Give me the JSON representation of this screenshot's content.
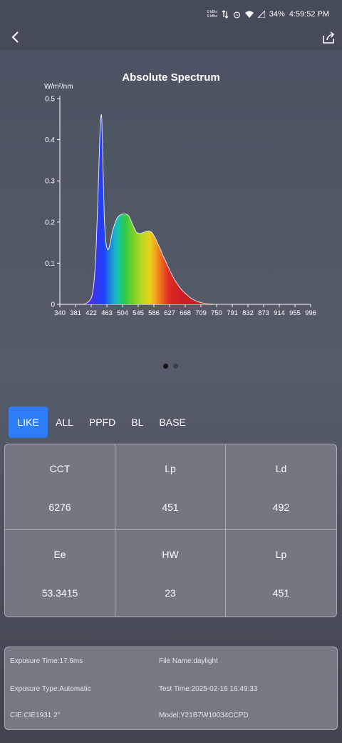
{
  "status": {
    "net_up": "0 kB/s",
    "net_down": "0 kB/s",
    "battery": "34%",
    "time": "4:59:52 PM"
  },
  "icons": {
    "back": "back-arrow-icon",
    "share": "share-icon"
  },
  "chart_data": {
    "type": "area",
    "title": "Absolute Spectrum",
    "ylabel": "W/m²/nm",
    "xlabel": "",
    "xlim": [
      340,
      996
    ],
    "ylim": [
      0,
      0.5
    ],
    "x_ticks": [
      "340",
      "381",
      "422",
      "463",
      "504",
      "545",
      "586",
      "627",
      "668",
      "709",
      "750",
      "791",
      "832",
      "873",
      "914",
      "955",
      "996"
    ],
    "y_ticks": [
      "0",
      "0.1",
      "0.2",
      "0.3",
      "0.4",
      "0.5"
    ],
    "x": [
      400,
      410,
      420,
      425,
      430,
      435,
      440,
      445,
      448,
      450,
      453,
      456,
      460,
      465,
      470,
      475,
      480,
      490,
      500,
      510,
      520,
      530,
      540,
      550,
      560,
      570,
      580,
      590,
      600,
      610,
      620,
      630,
      640,
      650,
      660,
      670,
      680,
      690,
      700,
      710,
      720,
      730,
      740,
      750,
      760,
      770,
      780,
      790
    ],
    "values": [
      0,
      0.003,
      0.012,
      0.025,
      0.06,
      0.14,
      0.27,
      0.42,
      0.46,
      0.44,
      0.33,
      0.22,
      0.155,
      0.133,
      0.142,
      0.165,
      0.185,
      0.21,
      0.218,
      0.22,
      0.215,
      0.195,
      0.176,
      0.172,
      0.175,
      0.178,
      0.175,
      0.16,
      0.14,
      0.118,
      0.098,
      0.078,
      0.06,
      0.046,
      0.034,
      0.025,
      0.017,
      0.011,
      0.007,
      0.004,
      0.002,
      0.001,
      0.0005,
      0,
      0,
      0,
      0,
      0
    ],
    "grid": false,
    "legend": "none"
  },
  "pagination": {
    "pages": 2,
    "current": 0
  },
  "tabs": [
    "LIKE",
    "ALL",
    "PPFD",
    "BL",
    "BASE"
  ],
  "metrics": [
    {
      "label": "CCT",
      "value": "6276"
    },
    {
      "label": "Lp",
      "value": "451"
    },
    {
      "label": "Ld",
      "value": "492"
    },
    {
      "label": "Ee",
      "value": "53.3415"
    },
    {
      "label": "HW",
      "value": "23"
    },
    {
      "label": "Lp",
      "value": "451"
    }
  ],
  "info": {
    "exposure_time": "Exposure Time:17.6ms",
    "file_name": "File Name:daylight",
    "exposure_type": "Exposure Type:Automatic",
    "test_time": "Test Time:2025-02-16 16:49:33",
    "cie": "CIE:CIE1931 2°",
    "model": "Model:Y21B7W10034CCPD"
  }
}
